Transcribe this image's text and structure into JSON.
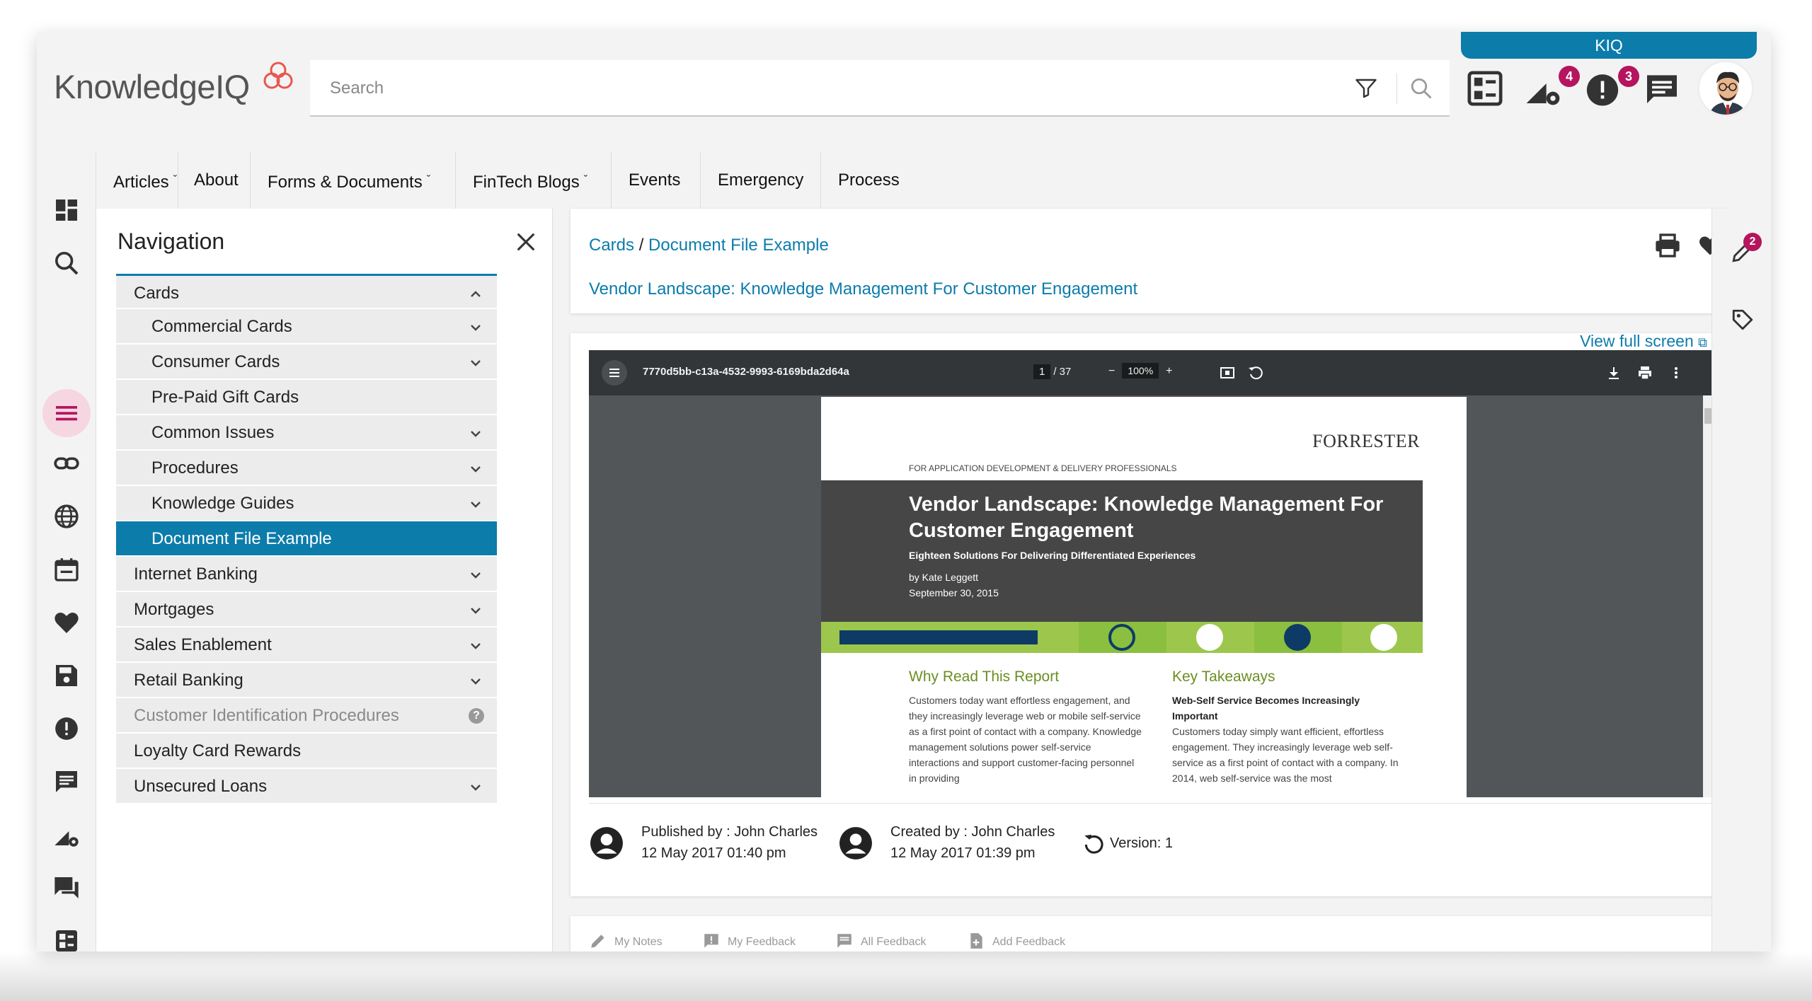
{
  "header": {
    "logo_text": "KnowledgeIQ",
    "search_placeholder": "Search",
    "kiq_label": "KIQ",
    "badges": {
      "settings": "4",
      "alerts": "3"
    }
  },
  "topnav": {
    "items": [
      "Articles",
      "About",
      "Forms & Documents",
      "FinTech Blogs",
      "Events",
      "Emergency",
      "Process"
    ]
  },
  "navigation": {
    "title": "Navigation",
    "items": [
      {
        "label": "Cards"
      },
      {
        "label": "Commercial Cards"
      },
      {
        "label": "Consumer Cards"
      },
      {
        "label": "Pre-Paid Gift Cards"
      },
      {
        "label": "Common Issues"
      },
      {
        "label": "Procedures"
      },
      {
        "label": "Knowledge Guides"
      },
      {
        "label": "Document File Example"
      },
      {
        "label": "Internet Banking"
      },
      {
        "label": "Mortgages"
      },
      {
        "label": "Sales Enablement"
      },
      {
        "label": "Retail Banking"
      },
      {
        "label": "Customer Identification Procedures"
      },
      {
        "label": "Loyalty Card Rewards"
      },
      {
        "label": "Unsecured Loans"
      }
    ]
  },
  "breadcrumb": {
    "root": "Cards",
    "separator": "/",
    "current": "Document File Example"
  },
  "document": {
    "title": "Vendor Landscape: Knowledge Management For Customer Engagement",
    "view_full_screen": "View full screen"
  },
  "pdf": {
    "filename": "7770d5bb-c13a-4532-9993-6169bda2d64a",
    "page_current": "1",
    "page_total": "/ 37",
    "zoom": "100%",
    "brand": "FORRESTER",
    "audience": "FOR APPLICATION DEVELOPMENT & DELIVERY PROFESSIONALS",
    "report_title": "Vendor Landscape: Knowledge Management For Customer Engagement",
    "report_subtitle": "Eighteen Solutions For Delivering Differentiated Experiences",
    "author": "by Kate Leggett",
    "date": "September 30, 2015",
    "why_heading": "Why Read This Report",
    "why_text": "Customers today want effortless engagement, and they increasingly leverage web or mobile self-service as a first point of contact with a company. Knowledge management solutions power self-service interactions and support customer-facing personnel in providing",
    "takeaways_heading": "Key Takeaways",
    "takeaways_bold": "Web-Self Service Becomes Increasingly Important",
    "takeaways_text": "Customers today simply want efficient, effortless engagement. They increasingly leverage web self- service as a first point of contact with a company. In 2014, web self-service was the most"
  },
  "meta": {
    "published_by": "Published by : John Charles",
    "published_date": "12 May 2017 01:40 pm",
    "created_by": "Created by : John Charles",
    "created_date": "12 May 2017 01:39 pm",
    "version": "Version: 1"
  },
  "feedback_tabs": [
    "My Notes",
    "My Feedback",
    "All Feedback",
    "Add Feedback"
  ],
  "right_rail": {
    "edit_badge": "2"
  },
  "colors": {
    "accent": "#0c7cab",
    "badge": "#b5145e",
    "green_band": "#9cc74c",
    "navy": "#0d3b66"
  }
}
